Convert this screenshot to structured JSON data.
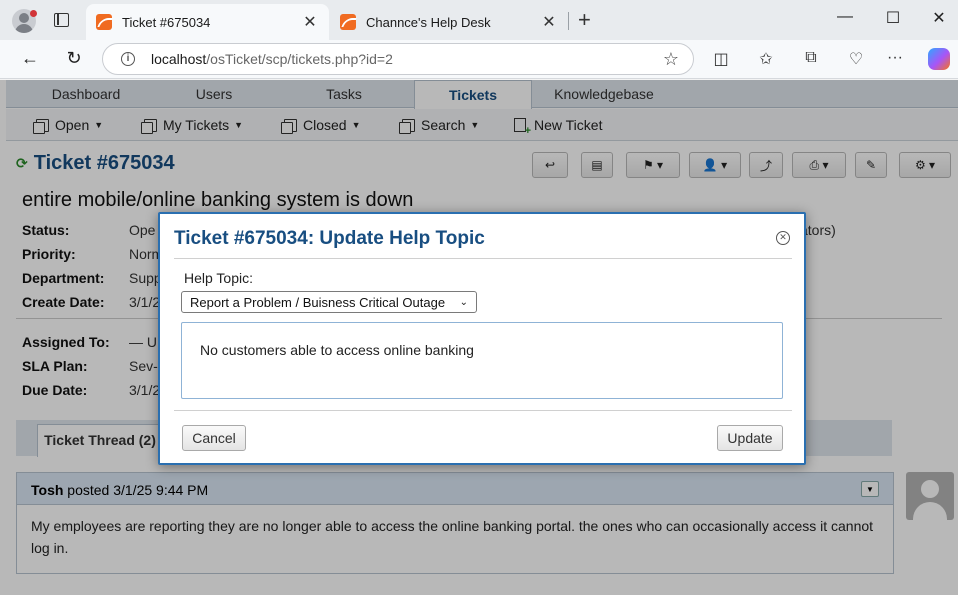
{
  "browser": {
    "tabs": [
      {
        "title": "Ticket #675034",
        "active": true
      },
      {
        "title": "Channce's Help Desk",
        "active": false
      }
    ],
    "url_host": "localhost",
    "url_path": "/osTicket/scp/tickets.php?id=2"
  },
  "nav": {
    "tabs": [
      "Dashboard",
      "Users",
      "Tasks",
      "Tickets",
      "Knowledgebase"
    ],
    "active_tab": "Tickets",
    "subnav": [
      "Open",
      "My Tickets",
      "Closed",
      "Search",
      "New Ticket"
    ]
  },
  "ticket": {
    "title": "Ticket #675034",
    "subject": "entire mobile/online banking system is down",
    "fields": [
      {
        "label": "Status:",
        "value": "Ope"
      },
      {
        "label": "Priority:",
        "value": "Norm"
      },
      {
        "label": "Department:",
        "value": "Supp"
      },
      {
        "label": "Create Date:",
        "value": "3/1/2"
      }
    ],
    "fields2": [
      {
        "label": "Assigned To:",
        "value": "— U"
      },
      {
        "label": "SLA Plan:",
        "value": "Sev-"
      },
      {
        "label": "Due Date:",
        "value": "3/1/2"
      }
    ],
    "right_fragment": "ators)",
    "thread_tab": "Ticket Thread (2)",
    "post": {
      "author": "Tosh",
      "meta": "posted 3/1/25 9:44 PM",
      "body": "My employees are reporting they are no longer able to access the online banking portal. the ones who can occasionally access it cannot log in."
    }
  },
  "modal": {
    "title": "Ticket #675034: Update Help Topic",
    "help_topic_label": "Help Topic:",
    "help_topic_value": "Report a Problem / Buisness Critical Outage",
    "comment": "No customers able to access online banking",
    "cancel_label": "Cancel",
    "update_label": "Update"
  }
}
